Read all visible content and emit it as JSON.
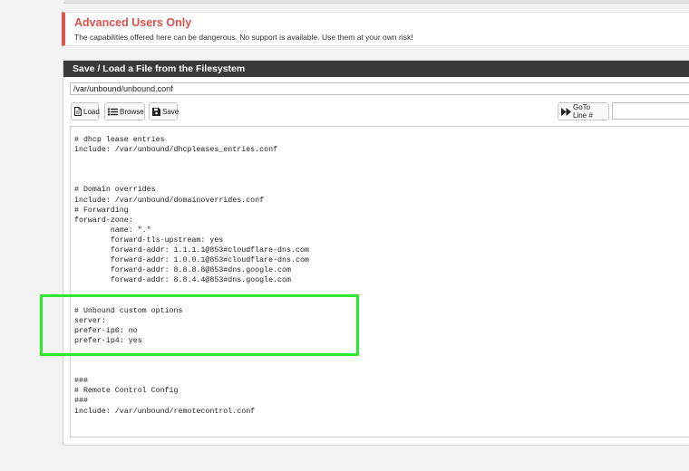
{
  "alert": {
    "title": "Advanced Users Only",
    "text": "The capabilities offered here can be dangerous. No support is available. Use them at your own risk!",
    "color": "#d9534f"
  },
  "panel": {
    "title": "Save / Load a File from the Filesystem"
  },
  "file": {
    "path": "/var/unbound/unbound.conf"
  },
  "toolbar": {
    "load_label": "Load",
    "browse_label": "Browse",
    "save_label": "Save",
    "goto_label": "GoTo Line #",
    "goto_value": ""
  },
  "editor": {
    "content": "# dhcp lease entries\ninclude: /var/unbound/dhcpleases_entries.conf\n\n\n\n# Domain overrides\ninclude: /var/unbound/domainoverrides.conf\n# Forwarding\nforward-zone:\n        name: \".\"\n        forward-tls-upstream: yes\n        forward-addr: 1.1.1.1@853#cloudflare-dns.com\n        forward-addr: 1.0.0.1@853#cloudflare-dns.com\n        forward-addr: 8.8.8.8@853#dns.google.com\n        forward-addr: 8.8.4.4@853#dns.google.com\n\n\n# Unbound custom options\nserver:\nprefer-ip6: no\nprefer-ip4: yes\n\n\n\n###\n# Remote Control Config\n###\ninclude: /var/unbound/remotecontrol.conf"
  },
  "highlight_color": "#2ee82e",
  "icons": {
    "load": "file-icon",
    "browse": "list-icon",
    "save": "floppy-icon",
    "goto": "fast-forward-icon"
  }
}
